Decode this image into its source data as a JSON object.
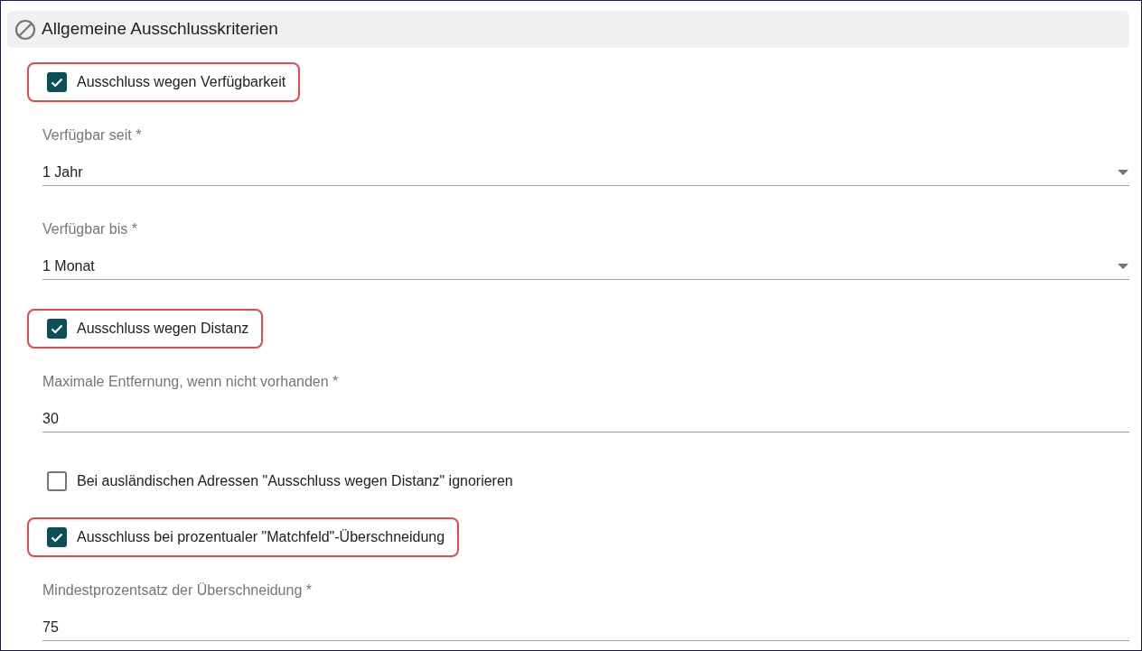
{
  "section": {
    "title": "Allgemeine Ausschlusskriterien"
  },
  "items": [
    {
      "kind": "checkbox",
      "label": "Ausschluss wegen Verfügbarkeit",
      "checked": true,
      "highlighted": true
    },
    {
      "kind": "select",
      "label": "Verfügbar seit *",
      "value": "1 Jahr"
    },
    {
      "kind": "select",
      "label": "Verfügbar bis *",
      "value": "1 Monat"
    },
    {
      "kind": "checkbox",
      "label": "Ausschluss wegen Distanz",
      "checked": true,
      "highlighted": true
    },
    {
      "kind": "text",
      "label": "Maximale Entfernung, wenn nicht vorhanden *",
      "value": "30"
    },
    {
      "kind": "checkbox",
      "label": "Bei ausländischen Adressen \"Ausschluss wegen Distanz\" ignorieren",
      "checked": false,
      "highlighted": false
    },
    {
      "kind": "checkbox",
      "label": "Ausschluss bei prozentualer \"Matchfeld\"-Überschneidung",
      "checked": true,
      "highlighted": true
    },
    {
      "kind": "text",
      "label": "Mindestprozentsatz der Überschneidung *",
      "value": "75"
    }
  ]
}
